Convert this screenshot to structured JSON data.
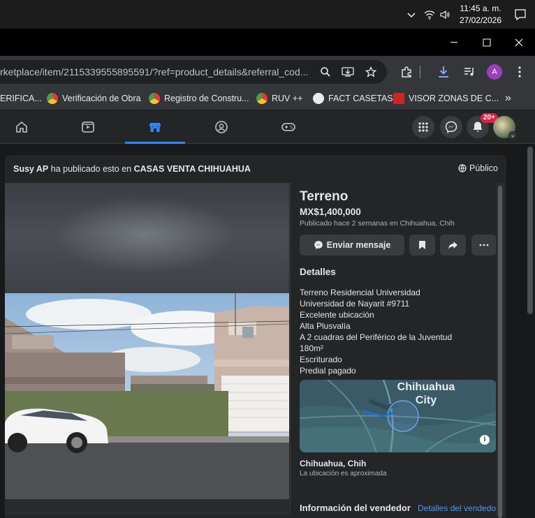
{
  "taskbar": {
    "time": "11:45 a. m.",
    "date": "27/02/2026",
    "icons": [
      "chevron-up-icon",
      "wifi-icon",
      "speaker-icon",
      "notifications-icon"
    ]
  },
  "window": {
    "controls": [
      "minimize",
      "maximize",
      "close"
    ]
  },
  "browser": {
    "url": "rketplace/item/2115339555895591/?ref=product_details&referral_cod...",
    "profile_initial": "A",
    "bookmarks": [
      {
        "label": "ERIFICA..."
      },
      {
        "label": "Verificación de Obra"
      },
      {
        "label": "Registro de Constru..."
      },
      {
        "label": "RUV ++"
      },
      {
        "label": "FACT CASETAS"
      },
      {
        "label": "VISOR ZONAS DE C..."
      }
    ],
    "more_bookmarks": "»"
  },
  "fb_nav": {
    "tabs": [
      "home-icon",
      "watch-icon",
      "marketplace-icon",
      "groups-icon",
      "gaming-icon"
    ],
    "active_tab": "marketplace",
    "notif_badge": "20+"
  },
  "post": {
    "author": "Susy AP",
    "published_text": " ha publicado esto en ",
    "group": "CASAS VENTA CHIHUAHUA",
    "privacy": "Público"
  },
  "listing": {
    "title": "Terreno",
    "price": "MX$1,400,000",
    "published": "Publicado hace 2 semanas en Chihuahua, Chih",
    "message_button": "Enviar mensaje",
    "details_heading": "Detalles",
    "description": [
      "Terreno Residencial Universidad",
      "Universidad de Nayarit #9711",
      "Excelente ubicación",
      "Alta Plusvalía",
      "A 2 cuadras del Periférico de la Juventud",
      "180m²",
      "Escriturado",
      "Predial pagado"
    ],
    "map_city": "Chihuahua City",
    "location": "Chihuahua, Chih",
    "location_note": "La ubicación es aproximada",
    "seller_heading": "Información del vendedor",
    "seller_link": "Detalles del vendedor"
  },
  "colors": {
    "accent": "#2d88ff",
    "badge": "#e41e3f",
    "link": "#4599ff"
  }
}
